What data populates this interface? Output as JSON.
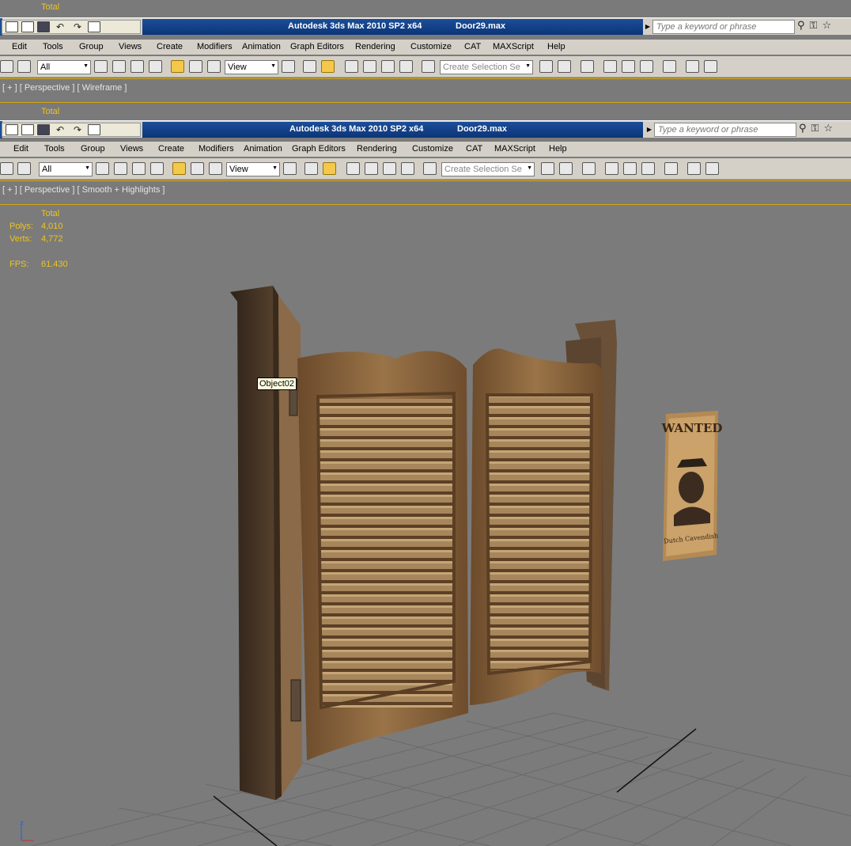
{
  "top_stats_label": "Total",
  "window": {
    "app_title": "Autodesk 3ds Max  2010 SP2 x64",
    "file_name": "Door29.max",
    "search_placeholder": "Type a keyword or phrase"
  },
  "menu": [
    "Edit",
    "Tools",
    "Group",
    "Views",
    "Create",
    "Modifiers",
    "Animation",
    "Graph Editors",
    "Rendering",
    "Customize",
    "CAT",
    "MAXScript",
    "Help"
  ],
  "toolbar": {
    "selection_filter": "All",
    "reference_coord": "View",
    "named_selection_placeholder": "Create Selection Se"
  },
  "viewport_top": {
    "label": "[ + ] [ Perspective ] [ Wireframe ]",
    "stat_label": "Total"
  },
  "viewport_main": {
    "label": "[ + ] [ Perspective ] [ Smooth + Highlights ]"
  },
  "stats": {
    "header": "Total",
    "polys_label": "Polys:",
    "polys_value": "4,010",
    "verts_label": "Verts:",
    "verts_value": "4,772",
    "fps_label": "FPS:",
    "fps_value": "61.430"
  },
  "object_tooltip": "Object02",
  "poster": {
    "headline": "WANTED",
    "name": "Dutch Cavendish"
  },
  "axis_label": "z",
  "colors": {
    "title_blue": "#0b3578",
    "stat_yellow": "#f0c419",
    "viewport_gray": "#7b7b7b",
    "active_tool": "#f4c84a"
  }
}
